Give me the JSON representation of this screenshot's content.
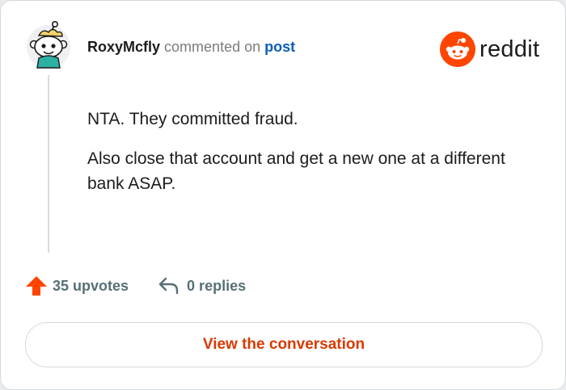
{
  "comment": {
    "username": "RoxyMcfly",
    "action_text": "commented on",
    "post_link_text": "post",
    "paragraphs": [
      "NTA. They committed fraud.",
      "Also close that account and get a new one at a different bank ASAP."
    ]
  },
  "brand": {
    "wordmark": "reddit",
    "logo_color": "#ff4500"
  },
  "stats": {
    "upvotes_label": "35 upvotes",
    "replies_label": "0 replies",
    "upvote_icon": "upvote-arrow-icon",
    "reply_icon": "reply-arrow-icon"
  },
  "cta": {
    "view_label": "View the conversation"
  },
  "colors": {
    "accent": "#ff4500",
    "cta_text": "#d93a00",
    "link": "#0b5fb4",
    "muted": "#576f76"
  }
}
